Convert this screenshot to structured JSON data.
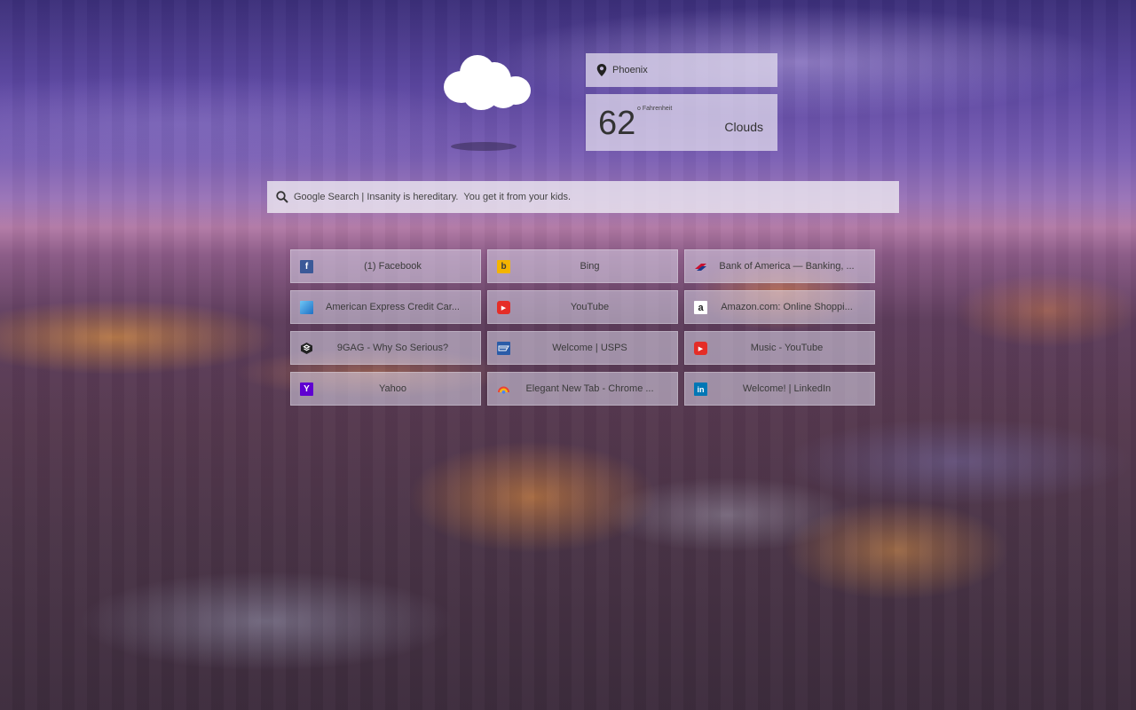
{
  "weather": {
    "location": "Phoenix",
    "temperature": "62",
    "unit": "o Fahrenheit",
    "condition": "Clouds",
    "icon": "cloud-icon"
  },
  "search": {
    "placeholder": "Google Search | Insanity is hereditary.  You get it from your kids."
  },
  "tiles": [
    {
      "label": "(1) Facebook",
      "icon": "facebook-icon",
      "color": "#3b5998"
    },
    {
      "label": "Bing",
      "icon": "bing-icon",
      "color": "#f4b400"
    },
    {
      "label": "Bank of America — Banking, ...",
      "icon": "bank-of-america-icon",
      "color": "#c8102e"
    },
    {
      "label": "American Express Credit Car...",
      "icon": "american-express-icon",
      "color": "#2a8fd6"
    },
    {
      "label": "YouTube",
      "icon": "youtube-icon",
      "color": "#e52d27"
    },
    {
      "label": "Amazon.com: Online Shoppi...",
      "icon": "amazon-icon",
      "color": "#222222"
    },
    {
      "label": "9GAG - Why So Serious?",
      "icon": "9gag-icon",
      "color": "#222222"
    },
    {
      "label": "Welcome | USPS",
      "icon": "usps-icon",
      "color": "#2a5ca8"
    },
    {
      "label": "Music - YouTube",
      "icon": "youtube-music-icon",
      "color": "#e52d27"
    },
    {
      "label": "Yahoo",
      "icon": "yahoo-icon",
      "color": "#5f01d1"
    },
    {
      "label": "Elegant New Tab - Chrome ...",
      "icon": "chrome-store-icon",
      "color": "#4285f4"
    },
    {
      "label": "Welcome! | LinkedIn",
      "icon": "linkedin-icon",
      "color": "#0077b5"
    }
  ]
}
